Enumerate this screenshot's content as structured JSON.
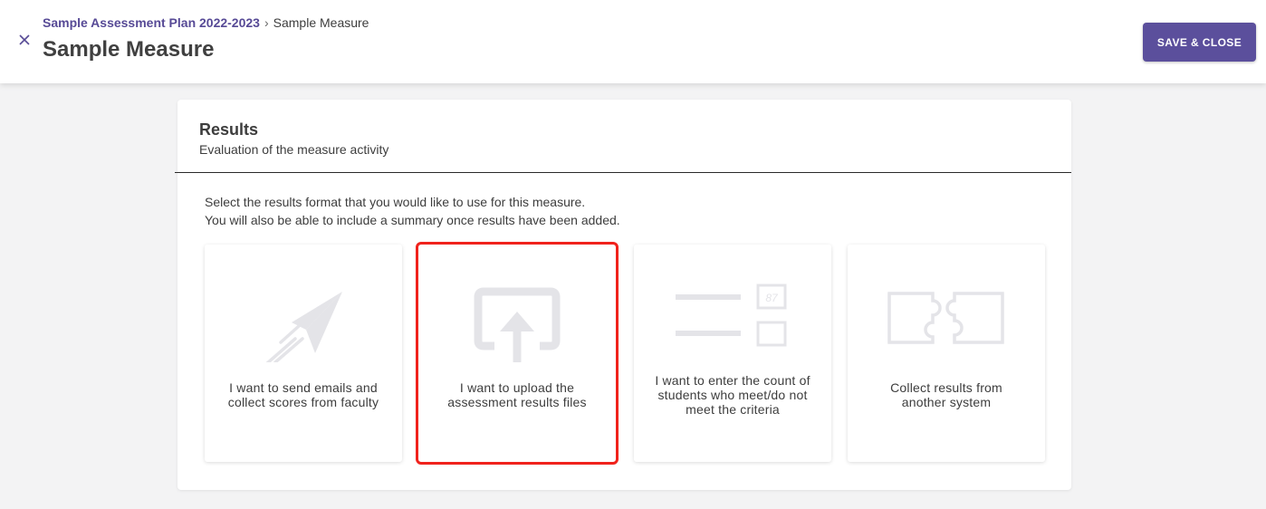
{
  "header": {
    "breadcrumb_parent": "Sample Assessment Plan 2022-2023",
    "breadcrumb_separator": "›",
    "breadcrumb_current": "Sample Measure",
    "title": "Sample Measure",
    "close_icon": "close-icon",
    "save_label": "SAVE & CLOSE"
  },
  "results": {
    "title": "Results",
    "subtitle": "Evaluation of the measure activity",
    "instruction_line1": "Select the results format that you would like to use for this measure.",
    "instruction_line2": "You will also be able to include a summary once results have been added.",
    "options": [
      {
        "label_line1": "I want to send emails and",
        "label_line2": "collect scores from faculty",
        "icon": "paper-plane-icon",
        "selected": false
      },
      {
        "label_line1": "I want to upload the",
        "label_line2": "assessment results files",
        "icon": "upload-icon",
        "selected": true
      },
      {
        "label_line1": "I want to enter the count of",
        "label_line2": "students who meet/do not",
        "label_line3": "meet the criteria",
        "icon": "count-entry-icon",
        "count_value": "87",
        "selected": false
      },
      {
        "label_line1": "Collect results from",
        "label_line2": "another system",
        "icon": "puzzle-icon",
        "selected": false
      }
    ]
  },
  "colors": {
    "accent": "#5b4f9c",
    "breadcrumb_link": "#574a96",
    "selection_outline": "#f0221c",
    "icon_gray": "#e4e4e8"
  }
}
